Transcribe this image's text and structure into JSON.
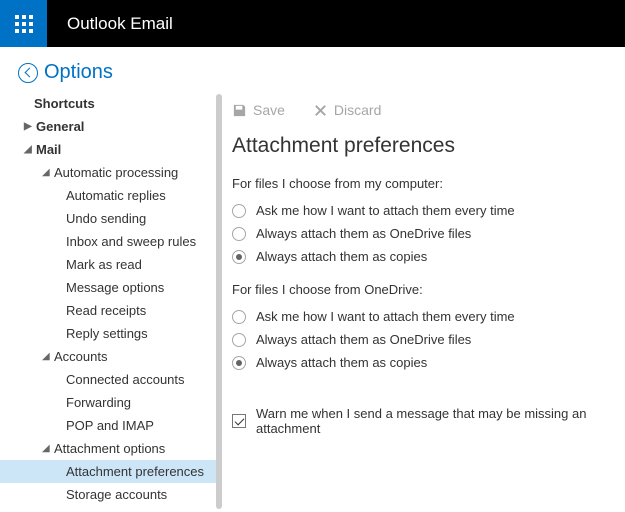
{
  "header": {
    "title": "Outlook Email"
  },
  "options": {
    "label": "Options"
  },
  "sidebar": {
    "shortcuts": "Shortcuts",
    "general": "General",
    "mail": "Mail",
    "auto_processing": "Automatic processing",
    "auto_replies": "Automatic replies",
    "undo_sending": "Undo sending",
    "inbox_sweep": "Inbox and sweep rules",
    "mark_as_read": "Mark as read",
    "message_options": "Message options",
    "read_receipts": "Read receipts",
    "reply_settings": "Reply settings",
    "accounts": "Accounts",
    "connected_accounts": "Connected accounts",
    "forwarding": "Forwarding",
    "pop_imap": "POP and IMAP",
    "attachment_options": "Attachment options",
    "attachment_preferences": "Attachment preferences",
    "storage_accounts": "Storage accounts"
  },
  "toolbar": {
    "save": "Save",
    "discard": "Discard"
  },
  "page": {
    "title": "Attachment preferences",
    "computer_label": "For files I choose from my computer:",
    "onedrive_label": "For files I choose from OneDrive:",
    "opt_ask": "Ask me how I want to attach them every time",
    "opt_onedrive": "Always attach them as OneDrive files",
    "opt_copies": "Always attach them as copies",
    "warn": "Warn me when I send a message that may be missing an attachment"
  }
}
